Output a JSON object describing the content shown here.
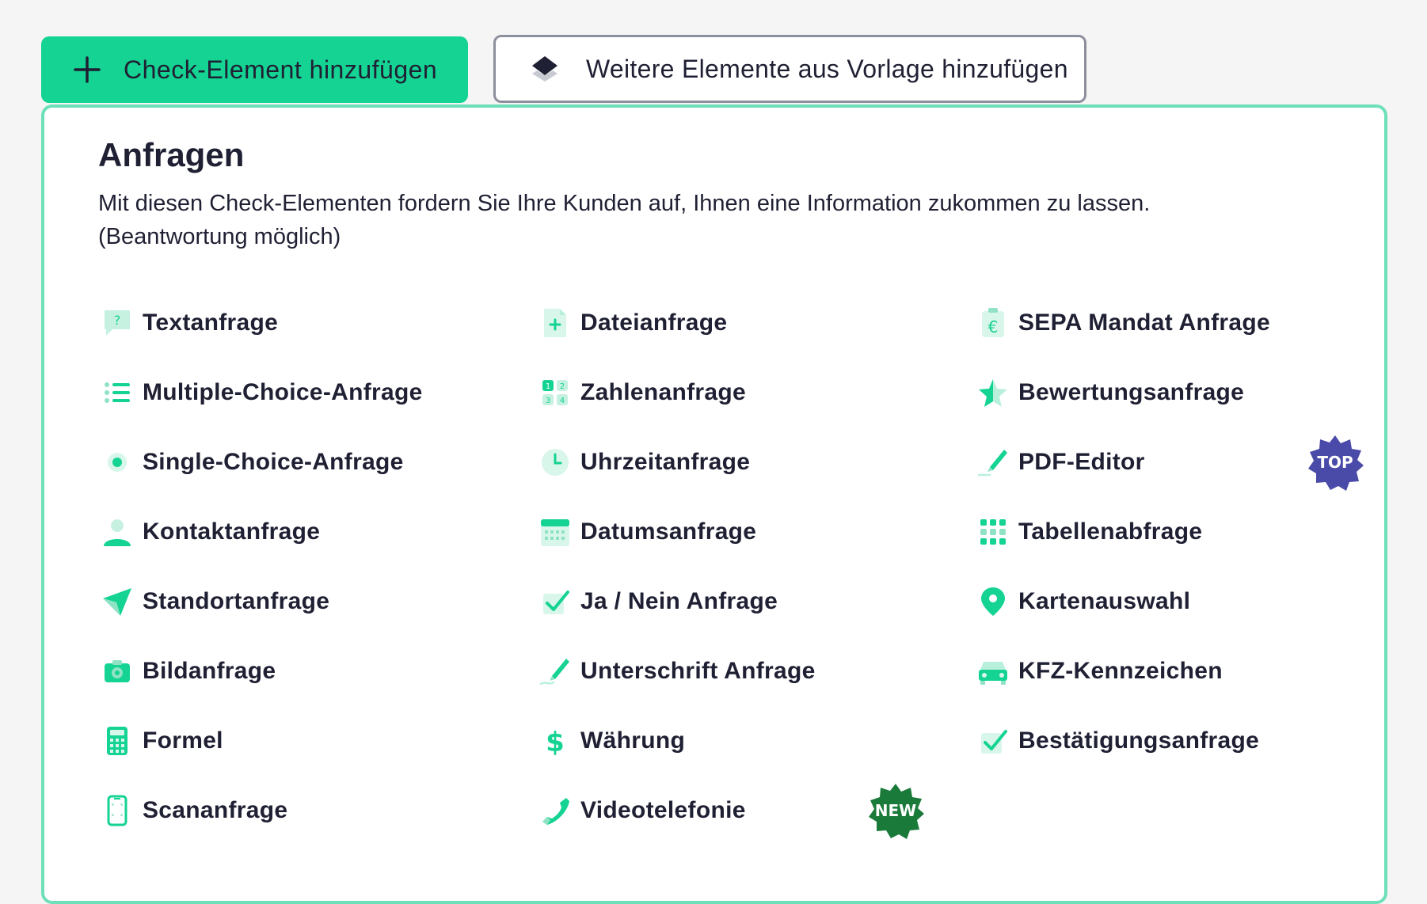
{
  "toolbar": {
    "add_label": "Check-Element hinzufügen",
    "template_label": "Weitere Elemente aus Vorlage hinzufügen"
  },
  "section": {
    "title": "Anfragen",
    "description": "Mit diesen Check-Elementen fordern Sie Ihre Kunden auf, Ihnen eine Information zukommen zu lassen. (Beantwortung möglich)"
  },
  "colors": {
    "accent": "#14d393",
    "accent_light": "#6ee0b8",
    "icon_mint": "#b9f0dc",
    "badge_top": "#4a4aa8",
    "badge_new": "#1a7a3a"
  },
  "items": {
    "col1": [
      {
        "label": "Textanfrage",
        "icon": "question-bubble-icon"
      },
      {
        "label": "Multiple-Choice-Anfrage",
        "icon": "list-icon"
      },
      {
        "label": "Single-Choice-Anfrage",
        "icon": "radio-icon"
      },
      {
        "label": "Kontaktanfrage",
        "icon": "person-icon"
      },
      {
        "label": "Standortanfrage",
        "icon": "navigation-arrow-icon"
      },
      {
        "label": "Bildanfrage",
        "icon": "camera-icon"
      },
      {
        "label": "Formel",
        "icon": "calculator-icon"
      },
      {
        "label": "Scananfrage",
        "icon": "phone-scan-icon"
      }
    ],
    "col2": [
      {
        "label": "Dateianfrage",
        "icon": "file-plus-icon"
      },
      {
        "label": "Zahlenanfrage",
        "icon": "number-grid-icon"
      },
      {
        "label": "Uhrzeitanfrage",
        "icon": "clock-icon"
      },
      {
        "label": "Datumsanfrage",
        "icon": "calendar-icon"
      },
      {
        "label": "Ja / Nein Anfrage",
        "icon": "checkbox-icon"
      },
      {
        "label": "Unterschrift Anfrage",
        "icon": "pen-signature-icon"
      },
      {
        "label": "Währung",
        "icon": "dollar-icon"
      },
      {
        "label": "Videotelefonie",
        "icon": "phone-icon",
        "badge": "NEW"
      }
    ],
    "col3": [
      {
        "label": "SEPA Mandat Anfrage",
        "icon": "euro-clipboard-icon"
      },
      {
        "label": "Bewertungsanfrage",
        "icon": "star-icon"
      },
      {
        "label": "PDF-Editor",
        "icon": "pen-icon",
        "badge": "TOP"
      },
      {
        "label": "Tabellenabfrage",
        "icon": "dot-grid-icon"
      },
      {
        "label": "Kartenauswahl",
        "icon": "map-pin-icon"
      },
      {
        "label": "KFZ-Kennzeichen",
        "icon": "car-icon"
      },
      {
        "label": "Bestätigungsanfrage",
        "icon": "check-confirm-icon"
      }
    ]
  }
}
